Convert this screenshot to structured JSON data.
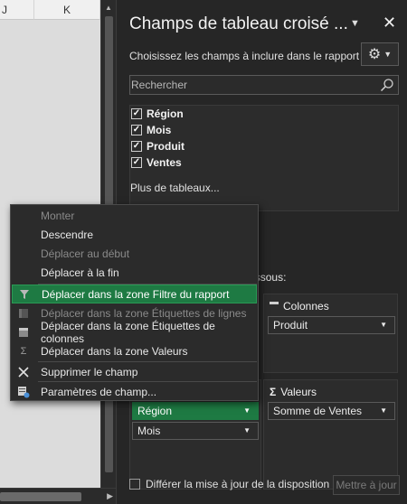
{
  "sheet": {
    "columns": [
      "J",
      "K"
    ]
  },
  "panel": {
    "title": "Champs de tableau croisé ...",
    "subtitle": "Choisissez les champs à inclure dans le rapport :",
    "search_placeholder": "Rechercher",
    "fields": [
      {
        "label": "Région",
        "checked": true
      },
      {
        "label": "Mois",
        "checked": true
      },
      {
        "label": "Produit",
        "checked": true
      },
      {
        "label": "Ventes",
        "checked": true
      }
    ],
    "more_tables": "Plus de tableaux...",
    "drag_text": "les zones voulues ci-dessous:",
    "columns_area": {
      "title": "Colonnes",
      "items": [
        "Produit"
      ]
    },
    "values_area": {
      "title": "Valeurs",
      "items": [
        "Somme de Ventes"
      ]
    },
    "rows_area": {
      "items": [
        "Région",
        "Mois"
      ]
    },
    "defer_label": "Différer la mise à jour de la disposition",
    "update_label": "Mettre à jour"
  },
  "context_menu": {
    "items": [
      {
        "label": "Monter",
        "disabled": true
      },
      {
        "label": "Descendre",
        "disabled": false
      },
      {
        "label": "Déplacer au début",
        "disabled": true
      },
      {
        "label": "Déplacer à la fin",
        "disabled": false
      },
      {
        "label": "Déplacer dans la zone Filtre du rapport",
        "disabled": false,
        "highlight": true,
        "icon": "filter-icon"
      },
      {
        "label": "Déplacer dans la zone Étiquettes de lignes",
        "disabled": true,
        "icon": "rows-icon"
      },
      {
        "label": "Déplacer dans la zone Étiquettes de colonnes",
        "disabled": false,
        "icon": "columns-icon"
      },
      {
        "label": "Déplacer dans la zone Valeurs",
        "disabled": false,
        "icon": "sigma-icon"
      },
      {
        "label": "Supprimer le champ",
        "disabled": false,
        "icon": "remove-x-icon"
      },
      {
        "label": "Paramètres de champ...",
        "disabled": false,
        "icon": "field-settings-icon"
      }
    ]
  },
  "colors": {
    "accent_green": "#1e7a43",
    "panel_bg": "#262626",
    "menu_bg": "#2b2b2b"
  }
}
